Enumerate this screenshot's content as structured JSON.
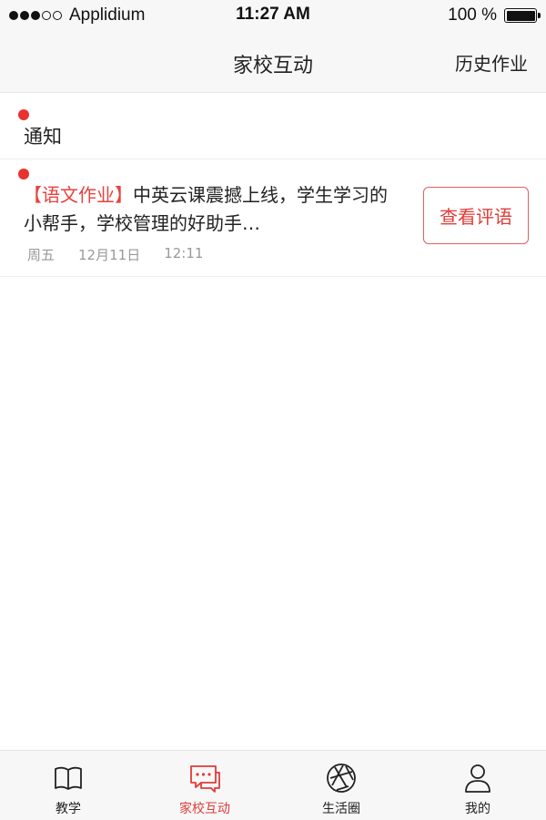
{
  "status_bar": {
    "carrier": "Applidium",
    "time": "11:27 AM",
    "battery": "100 %",
    "battery_level": 1.0,
    "signal_bars": 3,
    "signal_total": 5
  },
  "nav": {
    "title": "家校互动",
    "right_action": "历史作业"
  },
  "section": {
    "title": "通知"
  },
  "notices": [
    {
      "tag": "【语文作业】",
      "text": "中英云课震撼上线，学生学习的小帮手，学校管理的好助手…",
      "day": "周五",
      "date": "12月11日",
      "time": "12:11",
      "button_label": "查看评语"
    }
  ],
  "tabs": [
    {
      "label": "教学",
      "icon": "book-icon"
    },
    {
      "label": "家校互动",
      "icon": "chat-icon",
      "active": true
    },
    {
      "label": "生活圈",
      "icon": "aperture-icon"
    },
    {
      "label": "我的",
      "icon": "user-icon"
    }
  ],
  "colors": {
    "accent": "#e03c38",
    "tag": "#e8423e",
    "dot": "#e8322e",
    "meta": "#999999",
    "bar_bg": "#f7f7f7"
  }
}
